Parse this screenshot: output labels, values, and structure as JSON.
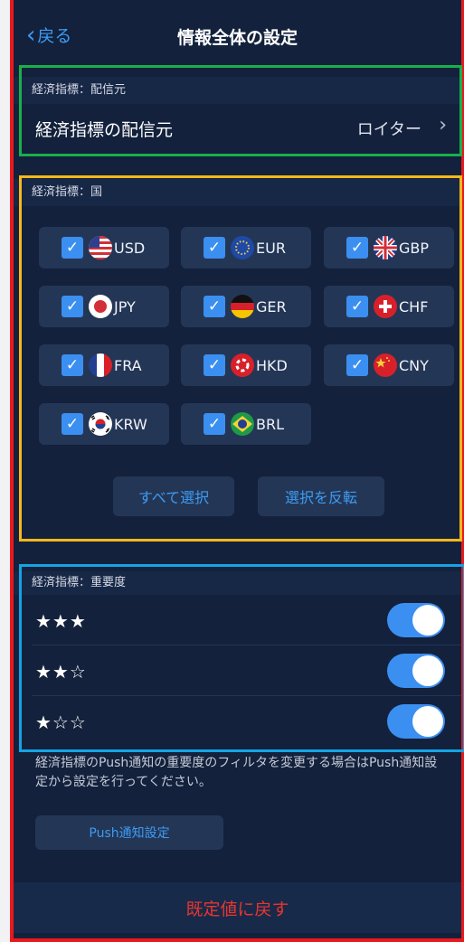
{
  "nav": {
    "back_label": "戻る",
    "title": "情報全体の設定"
  },
  "source_section": {
    "header": "経済指標：配信元",
    "row_label": "経済指標の配信元",
    "row_value": "ロイター"
  },
  "country_section": {
    "header": "経済指標：国",
    "countries": [
      {
        "code": "USD",
        "flag": "us-flag-icon",
        "checked": true
      },
      {
        "code": "EUR",
        "flag": "eu-flag-icon",
        "checked": true
      },
      {
        "code": "GBP",
        "flag": "uk-flag-icon",
        "checked": true
      },
      {
        "code": "JPY",
        "flag": "japan-flag-icon",
        "checked": true
      },
      {
        "code": "GER",
        "flag": "germany-flag-icon",
        "checked": true
      },
      {
        "code": "CHF",
        "flag": "swiss-flag-icon",
        "checked": true
      },
      {
        "code": "FRA",
        "flag": "france-flag-icon",
        "checked": true
      },
      {
        "code": "HKD",
        "flag": "hongkong-flag-icon",
        "checked": true
      },
      {
        "code": "CNY",
        "flag": "china-flag-icon",
        "checked": true
      },
      {
        "code": "KRW",
        "flag": "korea-flag-icon",
        "checked": true
      },
      {
        "code": "BRL",
        "flag": "brazil-flag-icon",
        "checked": true
      }
    ],
    "select_all_label": "すべて選択",
    "invert_label": "選択を反転"
  },
  "importance_section": {
    "header": "経済指標：重要度",
    "levels": [
      {
        "stars": "★★★",
        "on": true
      },
      {
        "stars": "★★☆",
        "on": true
      },
      {
        "stars": "★☆☆",
        "on": true
      }
    ]
  },
  "note": "経済指標のPush通知の重要度のフィルタを変更する場合はPush通知設定から設定を行ってください。",
  "push_button_label": "Push通知設定",
  "reset_label": "既定値に戻す",
  "colors": {
    "accent": "#3b8ff0",
    "reset": "#e8352f",
    "background": "#13213c"
  }
}
